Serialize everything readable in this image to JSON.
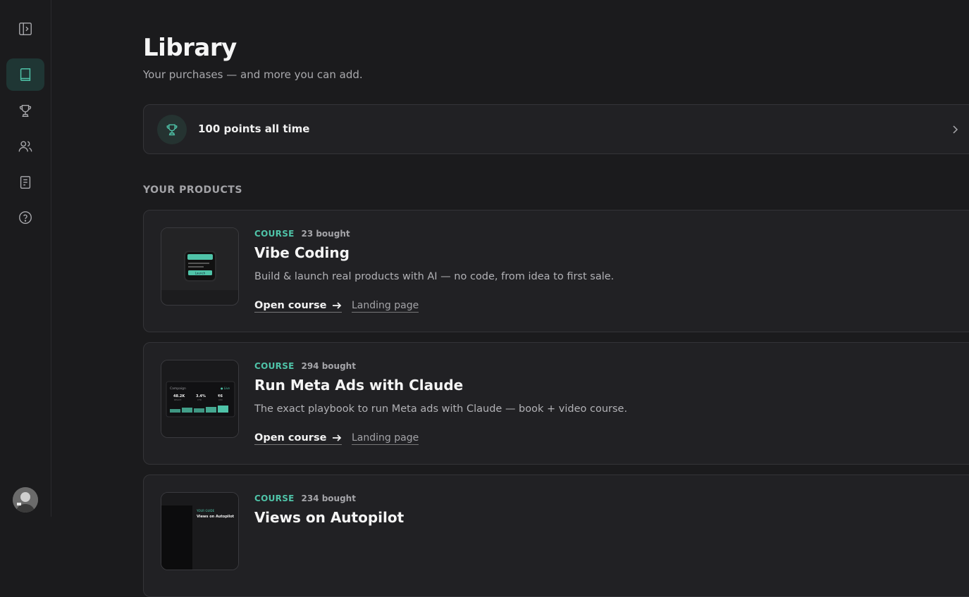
{
  "page": {
    "title": "Library",
    "subtitle": "Your purchases — and more you can add."
  },
  "points": {
    "label": "100 points all time"
  },
  "section": {
    "label": "YOUR PRODUCTS"
  },
  "products": [
    {
      "type": "COURSE",
      "bought": "23 bought",
      "name": "Vibe Coding",
      "description": "Build & launch real products with AI — no code, from idea to first sale.",
      "open_label": "Open course",
      "landing_label": "Landing page",
      "thumb_button": "Launch"
    },
    {
      "type": "COURSE",
      "bought": "294 bought",
      "name": "Run Meta Ads with Claude",
      "description": "The exact playbook to run Meta ads with Claude — book + video course.",
      "open_label": "Open course",
      "landing_label": "Landing page",
      "thumb": {
        "title": "Campaign",
        "status": "● Live",
        "stats": [
          {
            "value": "48.2K",
            "label": "REACH"
          },
          {
            "value": "3.4%",
            "label": "CTR"
          },
          {
            "value": "₹6",
            "label": "CPC"
          }
        ]
      }
    },
    {
      "type": "COURSE",
      "bought": "234 bought",
      "name": "Views on Autopilot",
      "thumb": {
        "kicker": "YOUR GUIDE",
        "title": "Views on Autopilot"
      }
    }
  ],
  "colors": {
    "accent": "#4fc3a8",
    "background": "#1b1b1d",
    "card": "#212124"
  }
}
